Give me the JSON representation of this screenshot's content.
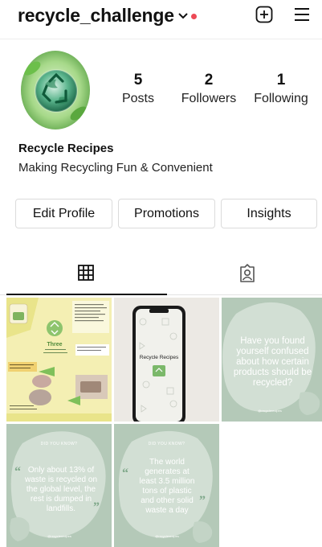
{
  "header": {
    "username": "recycle_challenge",
    "has_notification": true,
    "accent": "#ed4956",
    "add_icon": "plus-square-icon",
    "menu_icon": "hamburger-menu-icon"
  },
  "profile": {
    "stats": [
      {
        "value": "5",
        "label": "Posts"
      },
      {
        "value": "2",
        "label": "Followers"
      },
      {
        "value": "1",
        "label": "Following"
      }
    ],
    "name": "Recycle Recipes",
    "bio": "Making Recycling Fun & Convenient"
  },
  "actions": {
    "edit_profile": "Edit Profile",
    "promotions": "Promotions",
    "insights": "Insights"
  },
  "tabs": {
    "active": "grid",
    "grid_icon": "grid-icon",
    "tagged_icon": "tagged-person-icon"
  },
  "posts": {
    "post1": {
      "heading": "Three",
      "subheading": "Tips of up-cycling plastic lid of Wet wipes",
      "tag": "Hindi"
    },
    "post2": {
      "screen_title": "Recycle Recipes"
    },
    "post3": {
      "text": "Have you found yourself confused about how certain products should be recycled?"
    },
    "post4": {
      "kicker": "DID YOU KNOW?",
      "text": "Only about 13% of waste is recycled on the global level, the rest is dumped in landfills."
    },
    "post5": {
      "kicker": "DID YOU KNOW?",
      "text": "The world generates at least 3.5 million tons of plastic and other solid waste a day"
    }
  }
}
